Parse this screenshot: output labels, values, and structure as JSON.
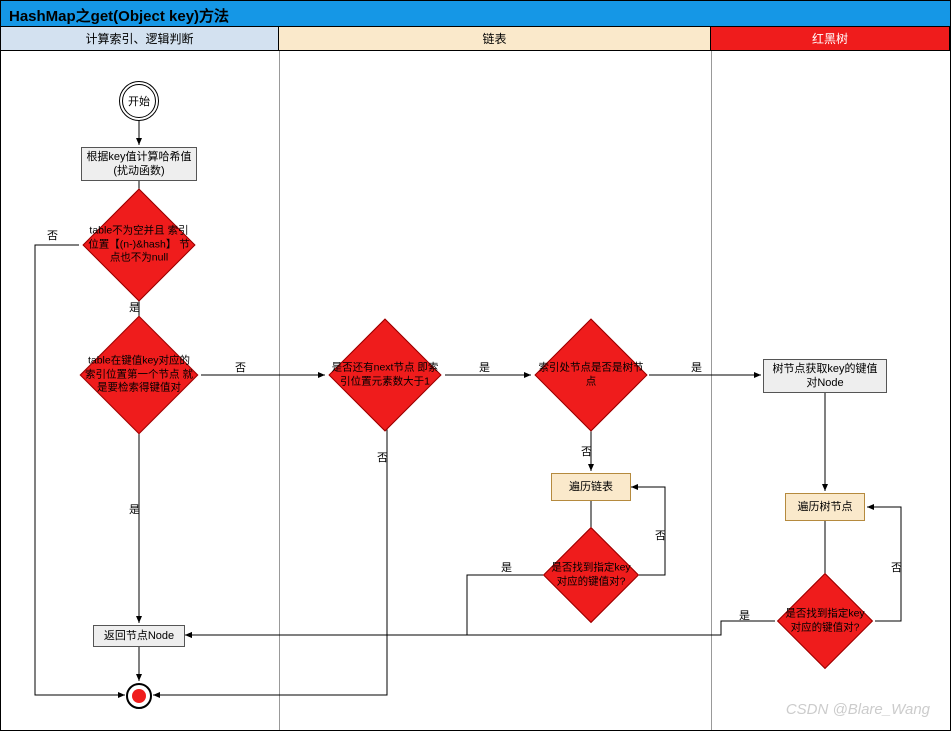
{
  "title": "HashMap之get(Object key)方法",
  "lanes": {
    "col1": "计算索引、逻辑判断",
    "col2": "链表",
    "col3": "红黑树"
  },
  "nodes": {
    "start": "开始",
    "hash": "根据key值计算哈希值\n(扰动函数)",
    "d_table": "table不为空并且\n索引位置【(n-)&hash】\n节点也不为null",
    "d_first": "table在键值key对应的\n索引位置第一个节点\n就是要检索得键值对",
    "d_next": "是否还有next节点\n即索引位置元素数大于1",
    "d_tree": "索引处节点是否是树节点",
    "iter_list": "遍历链表",
    "d_found_list": "是否找到指定key\n对应的键值对?",
    "tree_get": "树节点获取key的键值\n对Node",
    "iter_tree": "遍历树节点",
    "d_found_tree": "是否找到指定key\n对应的键值对?",
    "return": "返回节点Node"
  },
  "labels": {
    "yes": "是",
    "no": "否"
  },
  "watermark": "CSDN @Blare_Wang",
  "chart_data": {
    "type": "flowchart-swimlane",
    "title": "HashMap之get(Object key)方法",
    "swimlanes": [
      "计算索引、逻辑判断",
      "链表",
      "红黑树"
    ],
    "nodes": [
      {
        "id": "start",
        "lane": 0,
        "kind": "start",
        "text": "开始"
      },
      {
        "id": "hash",
        "lane": 0,
        "kind": "process",
        "text": "根据key值计算哈希值(扰动函数)"
      },
      {
        "id": "d_table",
        "lane": 0,
        "kind": "decision",
        "text": "table不为空并且索引位置【(n-)&hash】节点也不为null"
      },
      {
        "id": "d_first",
        "lane": 0,
        "kind": "decision",
        "text": "table在键值key对应的索引位置第一个节点就是要检索得键值对"
      },
      {
        "id": "return",
        "lane": 0,
        "kind": "process",
        "text": "返回节点Node"
      },
      {
        "id": "end",
        "lane": 0,
        "kind": "end"
      },
      {
        "id": "d_next",
        "lane": 1,
        "kind": "decision",
        "text": "是否还有next节点 即索引位置元素数大于1"
      },
      {
        "id": "d_tree",
        "lane": 1,
        "kind": "decision",
        "text": "索引处节点是否是树节点"
      },
      {
        "id": "iter_list",
        "lane": 1,
        "kind": "process",
        "text": "遍历链表"
      },
      {
        "id": "d_found_list",
        "lane": 1,
        "kind": "decision",
        "text": "是否找到指定key对应的键值对?"
      },
      {
        "id": "tree_get",
        "lane": 2,
        "kind": "process",
        "text": "树节点获取key的键值对Node"
      },
      {
        "id": "iter_tree",
        "lane": 2,
        "kind": "process",
        "text": "遍历树节点"
      },
      {
        "id": "d_found_tree",
        "lane": 2,
        "kind": "decision",
        "text": "是否找到指定key对应的键值对?"
      }
    ],
    "edges": [
      {
        "from": "start",
        "to": "hash"
      },
      {
        "from": "hash",
        "to": "d_table"
      },
      {
        "from": "d_table",
        "to": "d_first",
        "label": "是"
      },
      {
        "from": "d_table",
        "to": "end",
        "label": "否"
      },
      {
        "from": "d_first",
        "to": "return",
        "label": "是"
      },
      {
        "from": "d_first",
        "to": "d_next",
        "label": "否"
      },
      {
        "from": "d_next",
        "to": "d_tree",
        "label": "是"
      },
      {
        "from": "d_next",
        "to": "end",
        "label": "否"
      },
      {
        "from": "d_tree",
        "to": "tree_get",
        "label": "是"
      },
      {
        "from": "d_tree",
        "to": "iter_list",
        "label": "否"
      },
      {
        "from": "iter_list",
        "to": "d_found_list"
      },
      {
        "from": "d_found_list",
        "to": "return",
        "label": "是"
      },
      {
        "from": "d_found_list",
        "to": "iter_list",
        "label": "否"
      },
      {
        "from": "tree_get",
        "to": "iter_tree"
      },
      {
        "from": "iter_tree",
        "to": "d_found_tree"
      },
      {
        "from": "d_found_tree",
        "to": "return",
        "label": "是"
      },
      {
        "from": "d_found_tree",
        "to": "iter_tree",
        "label": "否"
      },
      {
        "from": "return",
        "to": "end"
      }
    ]
  }
}
